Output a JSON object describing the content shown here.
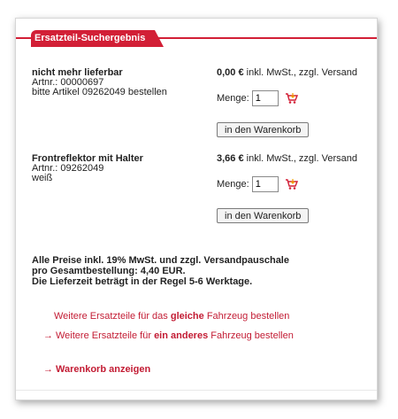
{
  "tab_title": "Ersatzteil-Suchergebnis",
  "items": [
    {
      "name": "nicht mehr lieferbar",
      "artnr": "Artnr.: 00000697",
      "extra": "bitte Artikel 09262049 bestellen",
      "price": "0,00 €",
      "price_note": " inkl. MwSt., zzgl. Versand",
      "qty_label": "Menge:",
      "qty_value": "1",
      "button": "in den Warenkorb"
    },
    {
      "name": "Frontreflektor mit Halter",
      "artnr": "Artnr.: 09262049",
      "extra": "weiß",
      "price": "3,66 €",
      "price_note": " inkl. MwSt., zzgl. Versand",
      "qty_label": "Menge:",
      "qty_value": "1",
      "button": "in den Warenkorb"
    }
  ],
  "note": {
    "line1": "Alle Preise inkl. 19% MwSt. und zzgl. Versandpauschale",
    "line2": "pro Gesamtbestellung: 4,40 EUR.",
    "line3": "Die Lieferzeit beträgt in der Regel 5-6 Werktage."
  },
  "links": {
    "same_pre": "Weitere Ersatzteile für das ",
    "same_bold": "gleiche",
    "same_post": " Fahrzeug bestellen",
    "arrow": "→",
    "other_pre": "Weitere Ersatzteile für ",
    "other_bold": "ein anderes",
    "other_post": " Fahrzeug bestellen",
    "cart": "Warenkorb anzeigen"
  },
  "colors": {
    "accent": "#d21f36",
    "link": "#c31c34"
  }
}
